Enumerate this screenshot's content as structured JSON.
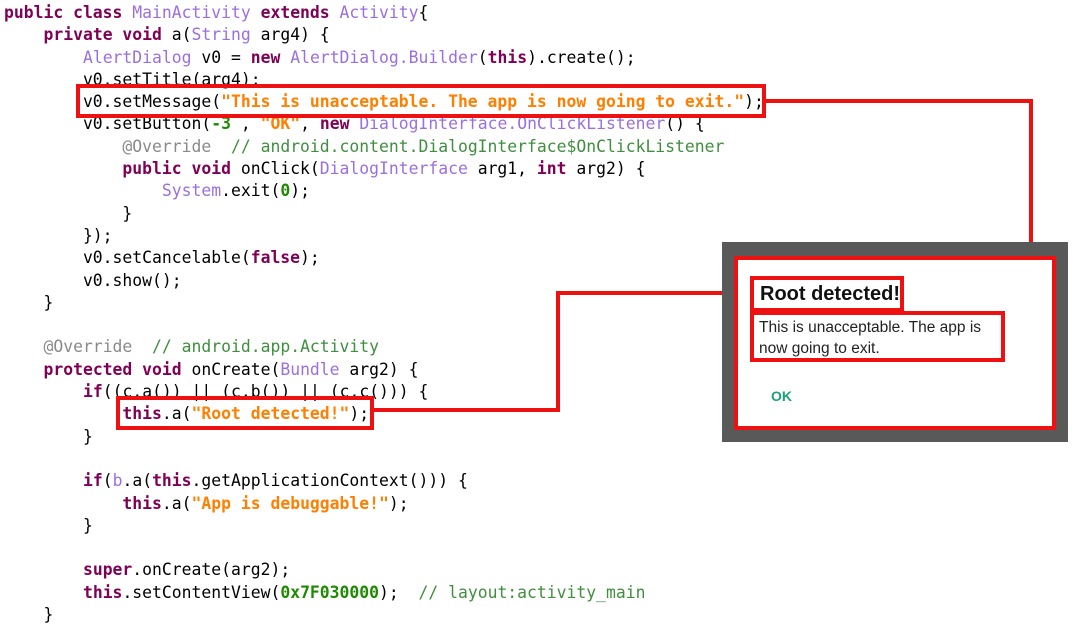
{
  "code": {
    "lines": [
      [
        [
          "kw",
          "public class "
        ],
        [
          "ty",
          "MainActivity"
        ],
        [
          "kw",
          " extends "
        ],
        [
          "ty",
          "Activity"
        ],
        [
          "",
          "{"
        ]
      ],
      [
        [
          "",
          "    "
        ],
        [
          "kw",
          "private void"
        ],
        [
          "",
          " a("
        ],
        [
          "ty",
          "String"
        ],
        [
          "",
          " arg4) {"
        ]
      ],
      [
        [
          "",
          "        "
        ],
        [
          "ty",
          "AlertDialog"
        ],
        [
          "",
          " v0 = "
        ],
        [
          "kw",
          "new "
        ],
        [
          "ty",
          "AlertDialog.Builder"
        ],
        [
          "",
          "("
        ],
        [
          "kw",
          "this"
        ],
        [
          "",
          ").create();"
        ]
      ],
      [
        [
          "",
          "        v0.setTitle(arg4);"
        ]
      ],
      [
        [
          "",
          "        v0.setMessage("
        ],
        [
          "st",
          "\"This is unacceptable. The app is now going to exit.\""
        ],
        [
          "",
          ");"
        ]
      ],
      [
        [
          "",
          "        v0.setButton("
        ],
        [
          "num",
          "-3"
        ],
        [
          "",
          " , "
        ],
        [
          "st",
          "\"OK\""
        ],
        [
          "",
          ", "
        ],
        [
          "kw",
          "new "
        ],
        [
          "ty",
          "DialogInterface.OnClickListener"
        ],
        [
          "",
          "() {"
        ]
      ],
      [
        [
          "",
          "            "
        ],
        [
          "an",
          "@Override"
        ],
        [
          "",
          "  "
        ],
        [
          "cm",
          "// android.content.DialogInterface$OnClickListener"
        ]
      ],
      [
        [
          "",
          "            "
        ],
        [
          "kw",
          "public void"
        ],
        [
          "",
          " onClick("
        ],
        [
          "ty",
          "DialogInterface"
        ],
        [
          "",
          " arg1, "
        ],
        [
          "kw",
          "int"
        ],
        [
          "",
          " arg2) {"
        ]
      ],
      [
        [
          "",
          "                "
        ],
        [
          "ty",
          "System"
        ],
        [
          "",
          ".exit("
        ],
        [
          "num",
          "0"
        ],
        [
          "",
          ");"
        ]
      ],
      [
        [
          "",
          "            }"
        ]
      ],
      [
        [
          "",
          "        });"
        ]
      ],
      [
        [
          "",
          "        v0.setCancelable("
        ],
        [
          "kw",
          "false"
        ],
        [
          "",
          ");"
        ]
      ],
      [
        [
          "",
          "        v0.show();"
        ]
      ],
      [
        [
          "",
          "    }"
        ]
      ],
      [
        [
          "",
          ""
        ]
      ],
      [
        [
          "",
          "    "
        ],
        [
          "an",
          "@Override"
        ],
        [
          "",
          "  "
        ],
        [
          "cm",
          "// android.app.Activity"
        ]
      ],
      [
        [
          "",
          "    "
        ],
        [
          "kw",
          "protected void"
        ],
        [
          "",
          " onCreate("
        ],
        [
          "ty",
          "Bundle"
        ],
        [
          "",
          " arg2) {"
        ]
      ],
      [
        [
          "",
          "        "
        ],
        [
          "kw",
          "if"
        ],
        [
          "",
          "(("
        ],
        [
          "u",
          "c"
        ],
        [
          "",
          ".a()) || ("
        ],
        [
          "u",
          "c"
        ],
        [
          "",
          ".b()) || ("
        ],
        [
          "u",
          "c"
        ],
        [
          "",
          ".c())) {"
        ]
      ],
      [
        [
          "",
          "            "
        ],
        [
          "kw",
          "this"
        ],
        [
          "",
          ".a("
        ],
        [
          "st",
          "\"Root detected!\""
        ],
        [
          "",
          ");"
        ]
      ],
      [
        [
          "",
          "        }"
        ]
      ],
      [
        [
          "",
          ""
        ]
      ],
      [
        [
          "",
          "        "
        ],
        [
          "kw",
          "if"
        ],
        [
          "",
          "("
        ],
        [
          "ty",
          "b"
        ],
        [
          "",
          ".a("
        ],
        [
          "kw",
          "this"
        ],
        [
          "",
          ".getApplicationContext())) {"
        ]
      ],
      [
        [
          "",
          "            "
        ],
        [
          "kw",
          "this"
        ],
        [
          "",
          ".a("
        ],
        [
          "st",
          "\"App is debuggable!\""
        ],
        [
          "",
          ");"
        ]
      ],
      [
        [
          "",
          "        }"
        ]
      ],
      [
        [
          "",
          ""
        ]
      ],
      [
        [
          "",
          "        "
        ],
        [
          "kw",
          "super"
        ],
        [
          "",
          ".onCreate(arg2);"
        ]
      ],
      [
        [
          "",
          "        "
        ],
        [
          "kw",
          "this"
        ],
        [
          "",
          ".setContentView("
        ],
        [
          "num",
          "0x7F030000"
        ],
        [
          "",
          ");  "
        ],
        [
          "cm",
          "// layout:activity_main"
        ]
      ],
      [
        [
          "",
          "    }"
        ]
      ]
    ]
  },
  "dialog": {
    "title": "Root detected!",
    "message": "This is unacceptable. The app is now going to exit.",
    "button_label": "OK"
  },
  "colors": {
    "highlight": "#ee1111",
    "dialog_frame": "#595959",
    "ok_button": "#1aa37a",
    "keyword": "#7f0055",
    "type": "#9b6fe0",
    "string": "#ff7f00",
    "number": "#1d8a00",
    "comment": "#3f8f3f"
  }
}
